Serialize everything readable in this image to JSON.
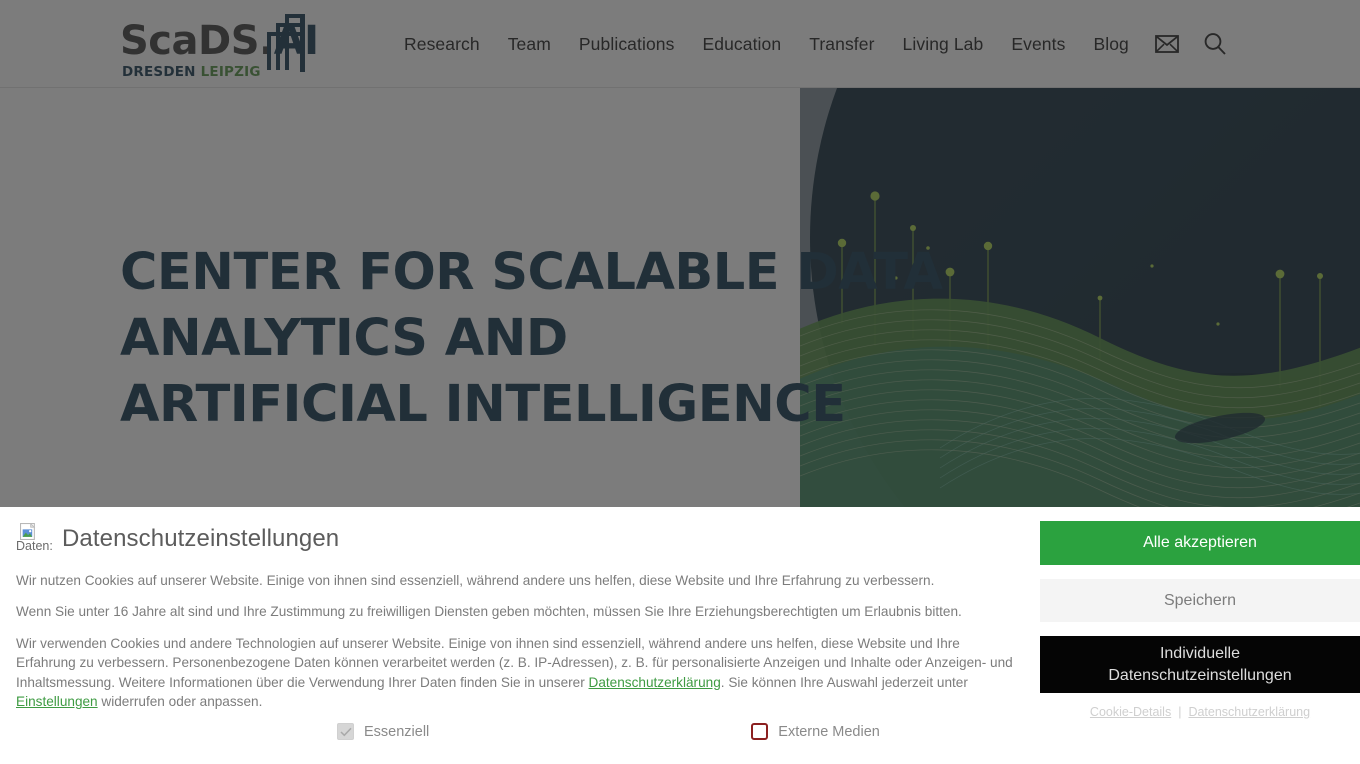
{
  "header": {
    "logo": {
      "word_main": "ScaDS.",
      "word_ai": "AI",
      "sub_dresden": "DRESDEN",
      "sub_leipzig": "LEIPZIG"
    },
    "nav": [
      {
        "label": "Research"
      },
      {
        "label": "Team"
      },
      {
        "label": "Publications"
      },
      {
        "label": "Education"
      },
      {
        "label": "Transfer"
      },
      {
        "label": "Living Lab"
      },
      {
        "label": "Events"
      },
      {
        "label": "Blog"
      }
    ],
    "icons": [
      {
        "name": "mail-icon",
        "glyph": "✉"
      },
      {
        "name": "search-icon",
        "glyph": "⚲"
      }
    ]
  },
  "hero": {
    "title": "Center for Scalable Data\nAnalytics and\nArtificial Intelligence"
  },
  "cookie": {
    "image_alt": "Daten:",
    "title": "Datenschutzeinstellungen",
    "paragraph1": "Wir nutzen Cookies auf unserer Website. Einige von ihnen sind essenziell, während andere uns helfen, diese Website und Ihre Erfahrung zu verbessern.",
    "paragraph2": "Wenn Sie unter 16 Jahre alt sind und Ihre Zustimmung zu freiwilligen Diensten geben möchten, müssen Sie Ihre Erziehungsberechtigten um Erlaubnis bitten.",
    "paragraph3_a": "Wir verwenden Cookies und andere Technologien auf unserer Website. Einige von ihnen sind essenziell, während andere uns helfen, diese Website und Ihre Erfahrung zu verbessern. Personenbezogene Daten können verarbeitet werden (z. B. IP-Adressen), z. B. für personalisierte Anzeigen und Inhalte oder Anzeigen- und Inhaltsmessung. Weitere Informationen über die Verwendung Ihrer Daten finden Sie in unserer ",
    "paragraph3_link1": "Datenschutzerklärung",
    "paragraph3_b": ". Sie können Ihre Auswahl jederzeit unter ",
    "paragraph3_link2": "Einstellungen",
    "paragraph3_c": " widerrufen oder anpassen.",
    "consent": [
      {
        "label": "Essenziell",
        "state": "checked-disabled"
      },
      {
        "label": "Externe Medien",
        "state": "unchecked"
      }
    ],
    "buttons": {
      "accept_all": "Alle akzeptieren",
      "save": "Speichern",
      "individual": "Individuelle\nDatenschutzeinstellungen"
    },
    "footer_links": [
      {
        "label": "Cookie-Details"
      },
      {
        "label": "Datenschutzerklärung"
      }
    ],
    "footer_separator": "|"
  },
  "colors": {
    "accent_green": "#2ba23f",
    "link_green": "#3e9b42",
    "brand_navy": "#11354c",
    "brand_leipzig_green": "#4f8f3f",
    "checkbox_red": "#8c2020",
    "individual_black": "#050505"
  }
}
